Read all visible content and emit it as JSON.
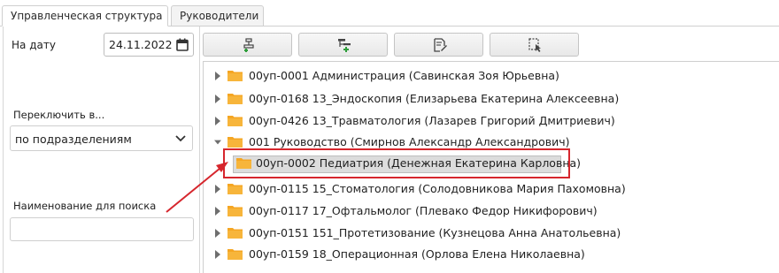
{
  "tabs": [
    {
      "label": "Управленческая структура",
      "active": true
    },
    {
      "label": "Руководители",
      "active": false
    }
  ],
  "left_panel": {
    "date_label": "На дату",
    "date_value": "24.11.2022",
    "switch_label": "Переключить в...",
    "switch_value": "по подразделениям",
    "search_label": "Наименование для поиска",
    "search_value": ""
  },
  "toolbar": {
    "buttons": [
      {
        "icon": "add-node-icon"
      },
      {
        "icon": "add-child-node-icon"
      },
      {
        "icon": "edit-document-icon"
      },
      {
        "icon": "select-cursor-icon"
      }
    ]
  },
  "tree": {
    "rows": [
      {
        "label": "00уп-0001 Администрация (Савинская Зоя Юрьевна)",
        "expanded": false
      },
      {
        "label": "00уп-0168 13_Эндоскопия (Елизарьева Екатерина Алексеевна)",
        "expanded": false
      },
      {
        "label": "00уп-0426 13_Травматология (Лазарев Григорий Дмитриевич)",
        "expanded": false
      },
      {
        "label": "001 Руководство (Смирнов Александр Александрович)",
        "expanded": true
      },
      {
        "label": "00уп-0002 Педиатрия (Денежная Екатерина Карловна)",
        "child": true,
        "selected": true
      },
      {
        "label": "00уп-0115 15_Стоматология (Солодовникова Мария Пахомовна)",
        "expanded": false
      },
      {
        "label": "00уп-0117 17_Офтальмолог (Плевако Федор Никифорович)",
        "expanded": false
      },
      {
        "label": "00уп-0151 151_Протетизование (Кузнецова Анна Анатольевна)",
        "expanded": false
      },
      {
        "label": "00уп-0159 18_Операционная (Орлова Елена Николаевна)",
        "expanded": false
      }
    ]
  },
  "colors": {
    "folder": "#f5a623",
    "selection": "#dcdcdc",
    "annotation": "#d6262d",
    "caret": "#6e6e6e"
  }
}
